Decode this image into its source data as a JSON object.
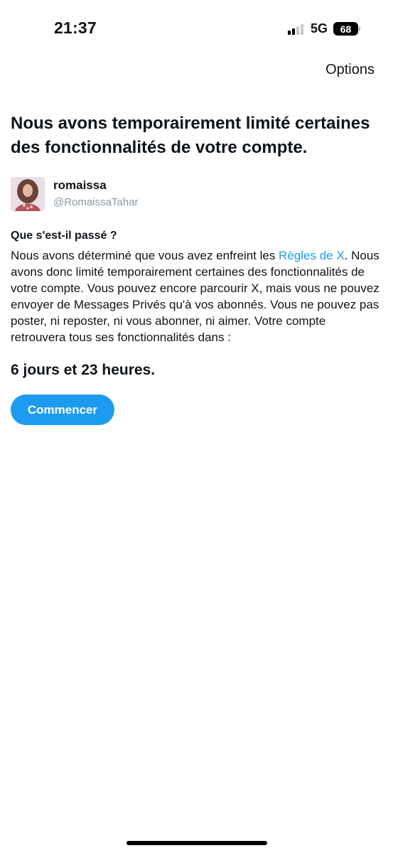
{
  "status_bar": {
    "time": "21:37",
    "network": "5G",
    "battery": "68"
  },
  "header": {
    "options_label": "Options"
  },
  "page": {
    "title": "Nous avons temporairement limité certaines des fonctionnalités de votre compte."
  },
  "profile": {
    "name": "romaissa",
    "handle": "@RomaissaTahar"
  },
  "explanation": {
    "heading": "Que s'est-il passé ?",
    "text_before_link": "Nous avons déterminé que vous avez enfreint les ",
    "link_text": "Règles de X",
    "text_after_link": ". Nous avons donc limité temporairement certaines des fonctionnalités de votre compte. Vous pouvez encore parcourir X, mais vous ne pouvez envoyer de Messages Privés qu'à vos abonnés. Vous ne pouvez pas poster, ni reposter, ni vous abonner, ni aimer. Votre compte retrouvera tous ses fonctionnalités dans :"
  },
  "countdown": "6 jours et 23 heures.",
  "actions": {
    "start_label": "Commencer"
  },
  "colors": {
    "accent": "#1d9bf0",
    "text": "#0f1419",
    "secondary_text": "#8a98a5"
  },
  "icons": [
    "signal-icon",
    "battery-icon",
    "avatar-image"
  ]
}
